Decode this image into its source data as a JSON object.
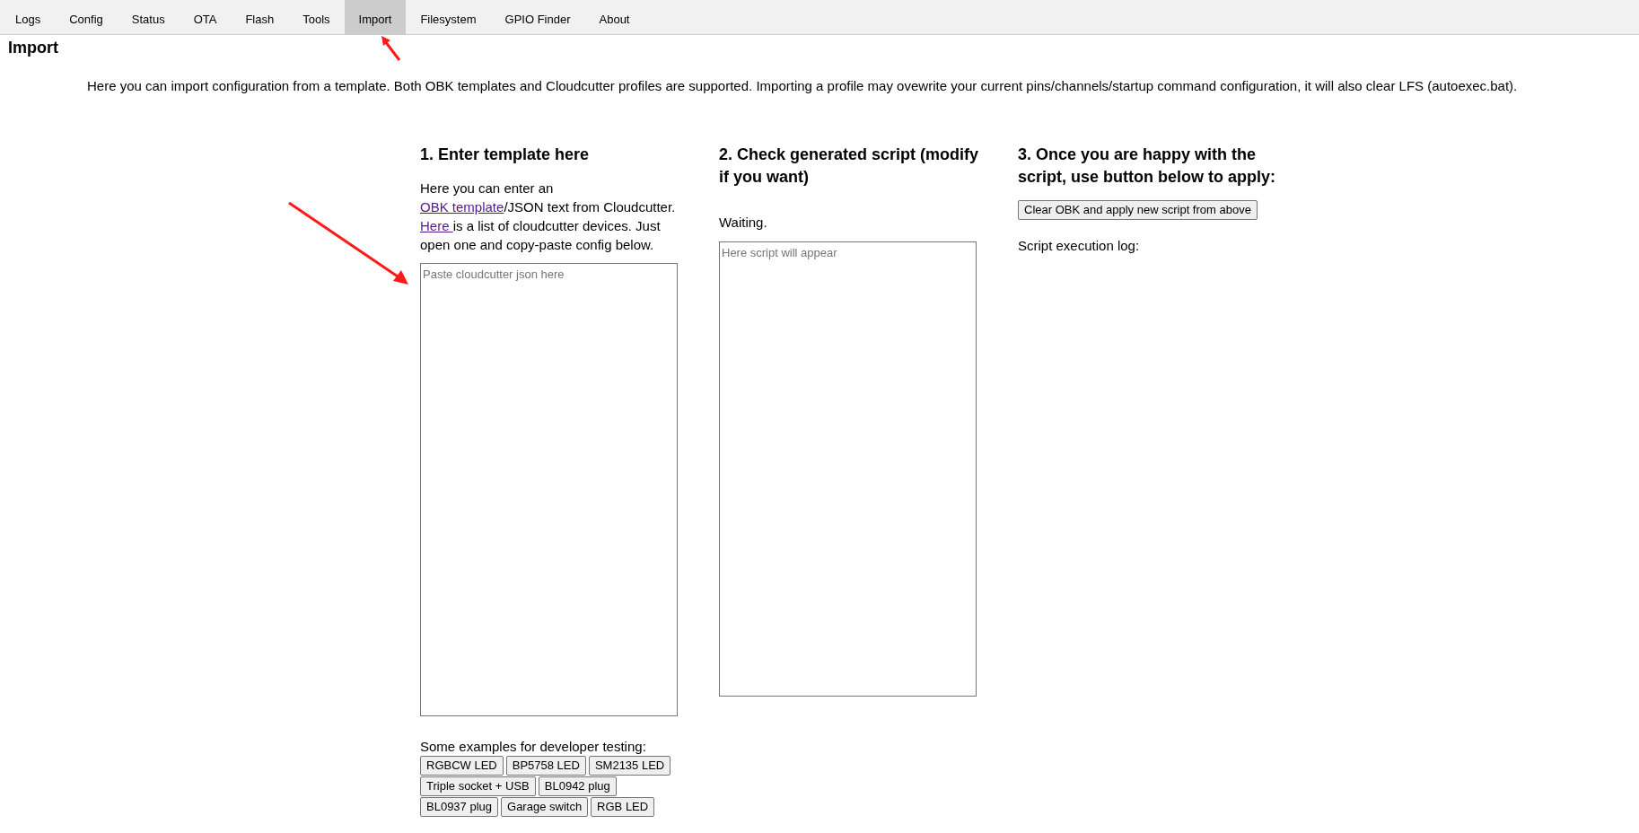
{
  "tabs": [
    {
      "label": "Logs",
      "selected": false
    },
    {
      "label": "Config",
      "selected": false
    },
    {
      "label": "Status",
      "selected": false
    },
    {
      "label": "OTA",
      "selected": false
    },
    {
      "label": "Flash",
      "selected": false
    },
    {
      "label": "Tools",
      "selected": false
    },
    {
      "label": "Import",
      "selected": true
    },
    {
      "label": "Filesystem",
      "selected": false
    },
    {
      "label": "GPIO Finder",
      "selected": false
    },
    {
      "label": "About",
      "selected": false
    }
  ],
  "page_title": "Import",
  "intro": "Here you can import configuration from a template. Both OBK templates and Cloudcutter profiles are supported. Importing a profile may ovewrite your current pins/channels/startup command configuration, it will also clear LFS (autoexec.bat).",
  "step1": {
    "heading": "1. Enter template here",
    "description": [
      {
        "kind": "text",
        "text": "Here you can enter an "
      },
      {
        "kind": "link",
        "text": "OBK template"
      },
      {
        "kind": "text",
        "text": "/JSON text from Cloudcutter. "
      },
      {
        "kind": "link",
        "text": "Here "
      },
      {
        "kind": "text",
        "text": "is a list of cloudcutter devices. Just open one and copy-paste config below."
      }
    ],
    "input": {
      "placeholder": "Paste cloudcutter json here"
    },
    "examples_label": "Some examples for developer testing:",
    "example_rows": [
      [
        "RGBCW LED",
        "BP5758 LED",
        "SM2135 LED"
      ],
      [
        "Triple socket + USB",
        "BL0942 plug"
      ],
      [
        "BL0937 plug",
        "Garage switch",
        "RGB LED"
      ]
    ]
  },
  "step2": {
    "heading": "2. Check generated script (modify if you want)",
    "status": "Waiting.",
    "output": {
      "placeholder": "Here script will appear"
    }
  },
  "step3": {
    "heading": "3. Once you are happy with the script, use button below to apply:",
    "button": "Clear OBK and apply new script from above",
    "log_label": "Script execution log:"
  }
}
